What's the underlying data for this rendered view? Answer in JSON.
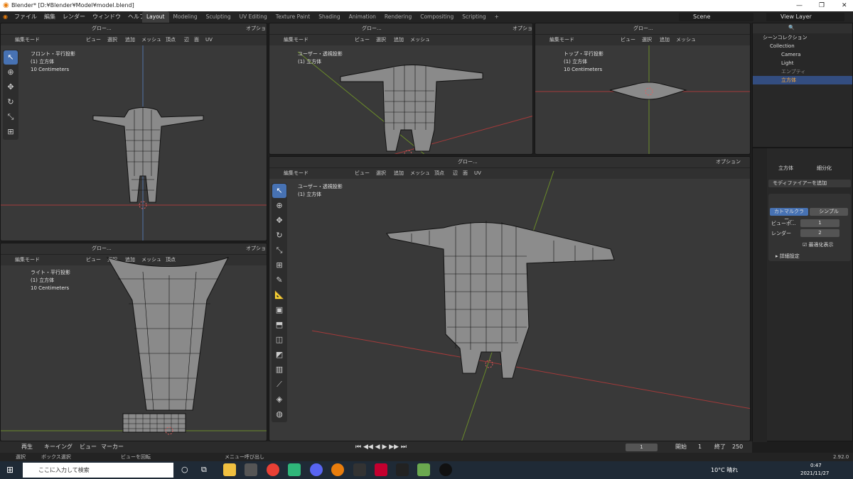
{
  "window": {
    "title": "Blender* [D:¥Blender¥Model¥model.blend]"
  },
  "menu": [
    "ファイル",
    "編集",
    "レンダー",
    "ウィンドウ",
    "ヘルプ"
  ],
  "workspace_tabs": [
    "Layout",
    "Modeling",
    "Sculpting",
    "UV Editing",
    "Texture Paint",
    "Shading",
    "Animation",
    "Rendering",
    "Compositing",
    "Scripting"
  ],
  "top": {
    "scene": "Scene",
    "view_layer": "View Layer"
  },
  "header": {
    "mode": "編集モード",
    "view": "ビュー",
    "select": "選択",
    "add": "追加",
    "mesh": "メッシュ",
    "vertex": "頂点",
    "edge": "辺",
    "face": "面",
    "uv": "UV",
    "transform": "グロー...",
    "options": "オプション"
  },
  "viewports": {
    "front": {
      "line1": "フロント・平行投影",
      "line2": "(1) 立方体",
      "line3": "10 Centimeters"
    },
    "user_top": {
      "line1": "ユーザー・透視投影",
      "line2": "(1) 立方体"
    },
    "top": {
      "line1": "トップ・平行投影",
      "line2": "(1) 立方体",
      "line3": "10 Centimeters"
    },
    "right": {
      "line1": "ライト・平行投影",
      "line2": "(1) 立方体",
      "line3": "10 Centimeters"
    },
    "main": {
      "line1": "ユーザー・透視投影",
      "line2": "(1) 立方体"
    }
  },
  "outliner": {
    "title": "シーンコレクション",
    "items": [
      "Collection",
      "Camera",
      "Light",
      "エンプティ",
      "立方体"
    ]
  },
  "properties": {
    "object": "立方体",
    "modifier": "細分化",
    "add_modifier": "モディファイアーを追加",
    "catmull": "カトマルクラー...",
    "simple": "シンプル",
    "viewport_label": "ビューポ...",
    "viewport_value": "1",
    "render_label": "レンダー",
    "render_value": "2",
    "optimal": "最適化表示",
    "advanced": "詳細設定"
  },
  "timeline": {
    "playback": "再生",
    "keying": "キーイング",
    "view": "ビュー",
    "marker": "マーカー",
    "frame": "1",
    "start_label": "開始",
    "start": "1",
    "end_label": "終了",
    "end": "250"
  },
  "status": {
    "select": "選択",
    "box": "ボックス選択",
    "rotate": "ビューを回転",
    "menu": "メニュー呼び出し",
    "version": "2.92.0"
  },
  "taskbar": {
    "search": "ここに入力して検索",
    "weather": "10°C 晴れ",
    "time": "0:47",
    "date": "2021/11/27"
  }
}
